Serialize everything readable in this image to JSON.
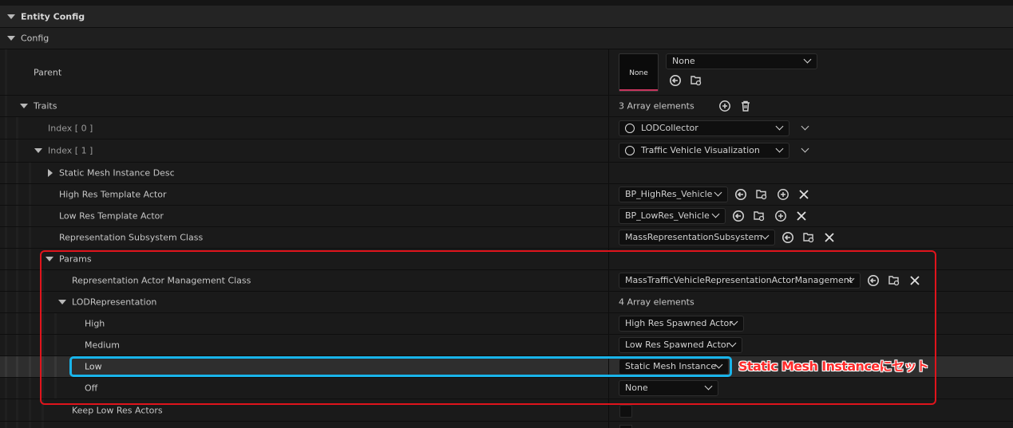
{
  "panel": {
    "entity_config": "Entity Config",
    "config": "Config",
    "parent": {
      "label": "Parent",
      "thumbnail": "None",
      "combo": "None"
    },
    "traits": {
      "label": "Traits",
      "count": "3 Array elements",
      "index0": {
        "label": "Index [ 0 ]",
        "value": "LODCollector"
      },
      "index1": {
        "label": "Index [ 1 ]",
        "value": "Traffic Vehicle Visualization"
      },
      "static_mesh_desc": "Static Mesh Instance Desc",
      "high_res_template": {
        "label": "High Res Template Actor",
        "value": "BP_HighRes_Vehicle"
      },
      "low_res_template": {
        "label": "Low Res Template Actor",
        "value": "BP_LowRes_Vehicle"
      },
      "representation_subsystem": {
        "label": "Representation Subsystem Class",
        "value": "MassRepresentationSubsystem"
      },
      "params": {
        "label": "Params",
        "actor_mgmt": {
          "label": "Representation Actor Management Class",
          "value": "MassTrafficVehicleRepresentationActorManagement"
        },
        "lod_representation": {
          "label": "LODRepresentation",
          "count": "4 Array elements",
          "high": {
            "label": "High",
            "value": "High Res Spawned Actor"
          },
          "medium": {
            "label": "Medium",
            "value": "Low Res Spawned Actor"
          },
          "low": {
            "label": "Low",
            "value": "Static Mesh Instance"
          },
          "off": {
            "label": "Off",
            "value": "None"
          }
        },
        "keep_low_res": {
          "label": "Keep Low Res Actors",
          "checked": false
        }
      }
    }
  },
  "annotation": {
    "text": "Static Mesh Instanceにセット",
    "red_box_color": "#e0141c",
    "blue_box_color": "#19b4ea"
  },
  "colors": {
    "background": "#151515",
    "row": "#1a1a1a",
    "header": "#242424",
    "highlight": "#2e2e2e",
    "thumbnail_accent": "#c8355e"
  }
}
